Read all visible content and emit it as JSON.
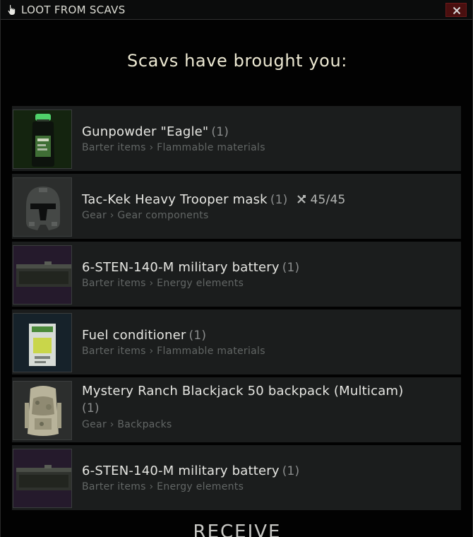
{
  "window": {
    "title": "LOOT FROM SCAVS",
    "heading": "Scavs have brought you:"
  },
  "items": [
    {
      "name": "Gunpowder \"Eagle\"",
      "qty": "(1)",
      "category": "Barter items › Flammable materials",
      "thumb_bg": "#14240f"
    },
    {
      "name": "Tac-Kek Heavy Trooper mask",
      "qty": "(1)",
      "durability": "45/45",
      "category": "Gear › Gear components",
      "thumb_bg": "#2c2e2d"
    },
    {
      "name": "6-STEN-140-M military battery",
      "qty": "(1)",
      "category": "Barter items › Energy elements",
      "thumb_bg": "#251a2c"
    },
    {
      "name": "Fuel conditioner",
      "qty": "(1)",
      "category": "Barter items › Flammable materials",
      "thumb_bg": "#16222a"
    },
    {
      "name": "Mystery Ranch Blackjack 50 backpack (Multicam)",
      "qty": "(1)",
      "category": "Gear › Backpacks",
      "thumb_bg": "#2c2e2d"
    },
    {
      "name": "6-STEN-140-M military battery",
      "qty": "(1)",
      "category": "Barter items › Energy elements",
      "thumb_bg": "#251a2c"
    }
  ],
  "footer": {
    "receive_label": "RECEIVE"
  },
  "colors": {
    "accent_close": "#4a0f0f",
    "text_primary": "#e6e6e2",
    "text_secondary": "#626665"
  },
  "icons": {
    "title": "hand-pointer-icon",
    "close": "close-icon",
    "durability": "wrench-icon"
  }
}
